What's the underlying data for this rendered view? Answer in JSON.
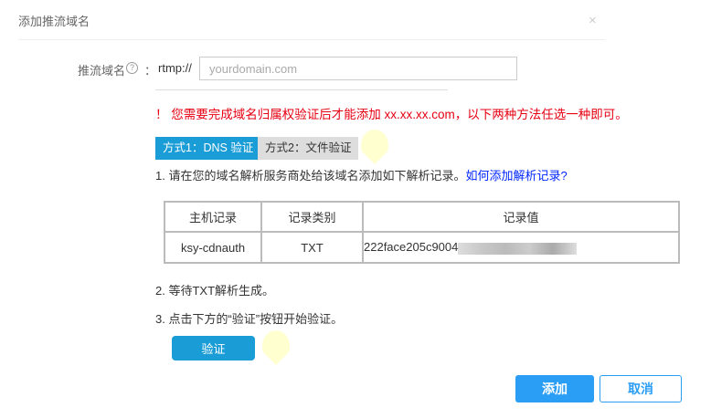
{
  "dialog": {
    "title": "添加推流域名",
    "close": "×"
  },
  "form": {
    "label": "推流域名",
    "help": "?",
    "colon": "：",
    "prefix": "rtmp://",
    "placeholder": "yourdomain.com",
    "value": ""
  },
  "warning": "！ 您需要完成域名归属权验证后才能添加 xx.xx.xx.com，以下两种方法任选一种即可。",
  "tabs": [
    {
      "label": "方式1：DNS 验证",
      "active": true
    },
    {
      "label": "方式2：文件验证",
      "active": false
    }
  ],
  "step1": {
    "text": "1. 请在您的域名解析服务商处给该域名添加如下解析记录。",
    "link": "如何添加解析记录?"
  },
  "table": {
    "headers": [
      "主机记录",
      "记录类别",
      "记录值"
    ],
    "rows": [
      [
        "ksy-cdnauth",
        "TXT",
        "222face205c9004"
      ]
    ]
  },
  "step2": "2. 等待TXT解析生成。",
  "step3": "3. 点击下方的“验证”按钮开始验证。",
  "buttons": {
    "verify": "验证",
    "add": "添加",
    "cancel": "取消"
  },
  "colors": {
    "accent": "#1a9cd6",
    "warning": "#e60012",
    "link": "#0026ff",
    "primary": "#2a9df4"
  }
}
